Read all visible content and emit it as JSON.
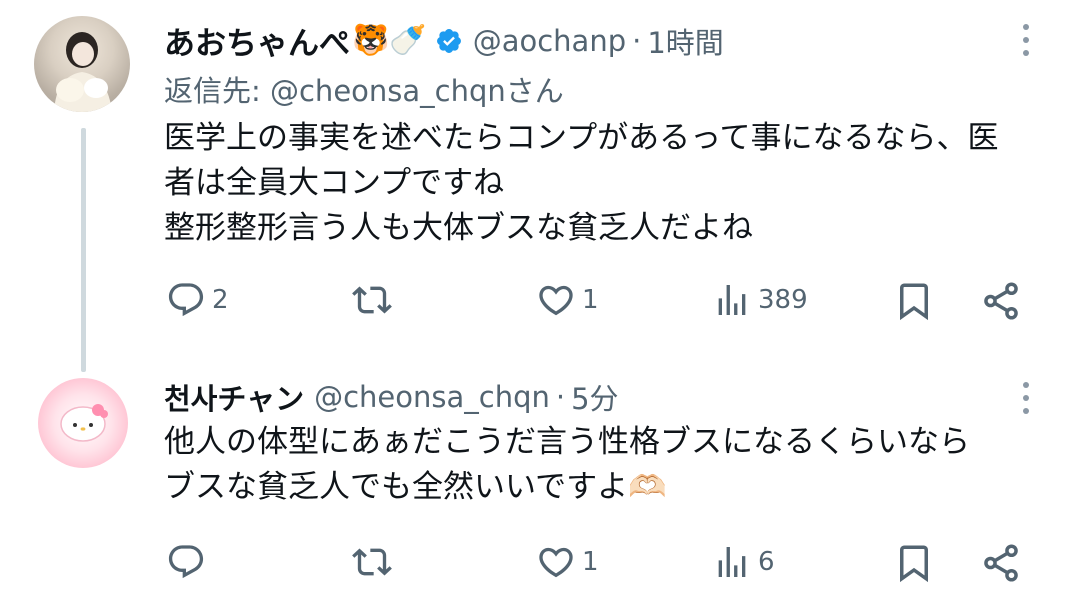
{
  "tweets": [
    {
      "name": "あおちゃんぺ",
      "name_emojis": "🐯🍼",
      "verified": true,
      "handle": "@aochanp",
      "separator": "·",
      "time": "1時間",
      "reply_to": "返信先: @cheonsa_chqnさん",
      "lines": [
        "医学上の事実を述べたらコンプがあるって事になるなら、医",
        "者は全員大コンプですね",
        "整形整形言う人も大体ブスな貧乏人だよね"
      ],
      "actions": {
        "replies": "2",
        "retweets": "",
        "likes": "1",
        "views": "389"
      }
    },
    {
      "name": "천사チャン",
      "handle": "@cheonsa_chqn",
      "separator": "·",
      "time": "5分",
      "lines": [
        "他人の体型にあぁだこうだ言う性格ブスになるくらいなら",
        "ブスな貧乏人でも全然いいですよ🫶🏻"
      ],
      "actions": {
        "replies": "",
        "retweets": "",
        "likes": "1",
        "views": "6"
      }
    }
  ],
  "colors": {
    "text": "#0f1419",
    "secondary": "#536471",
    "verified": "#1d9bf0",
    "thread_line": "#cfd9de"
  },
  "icons": [
    "reply-icon",
    "retweet-icon",
    "like-icon",
    "views-icon",
    "bookmark-icon",
    "share-icon",
    "more-icon",
    "verified-badge-icon"
  ]
}
